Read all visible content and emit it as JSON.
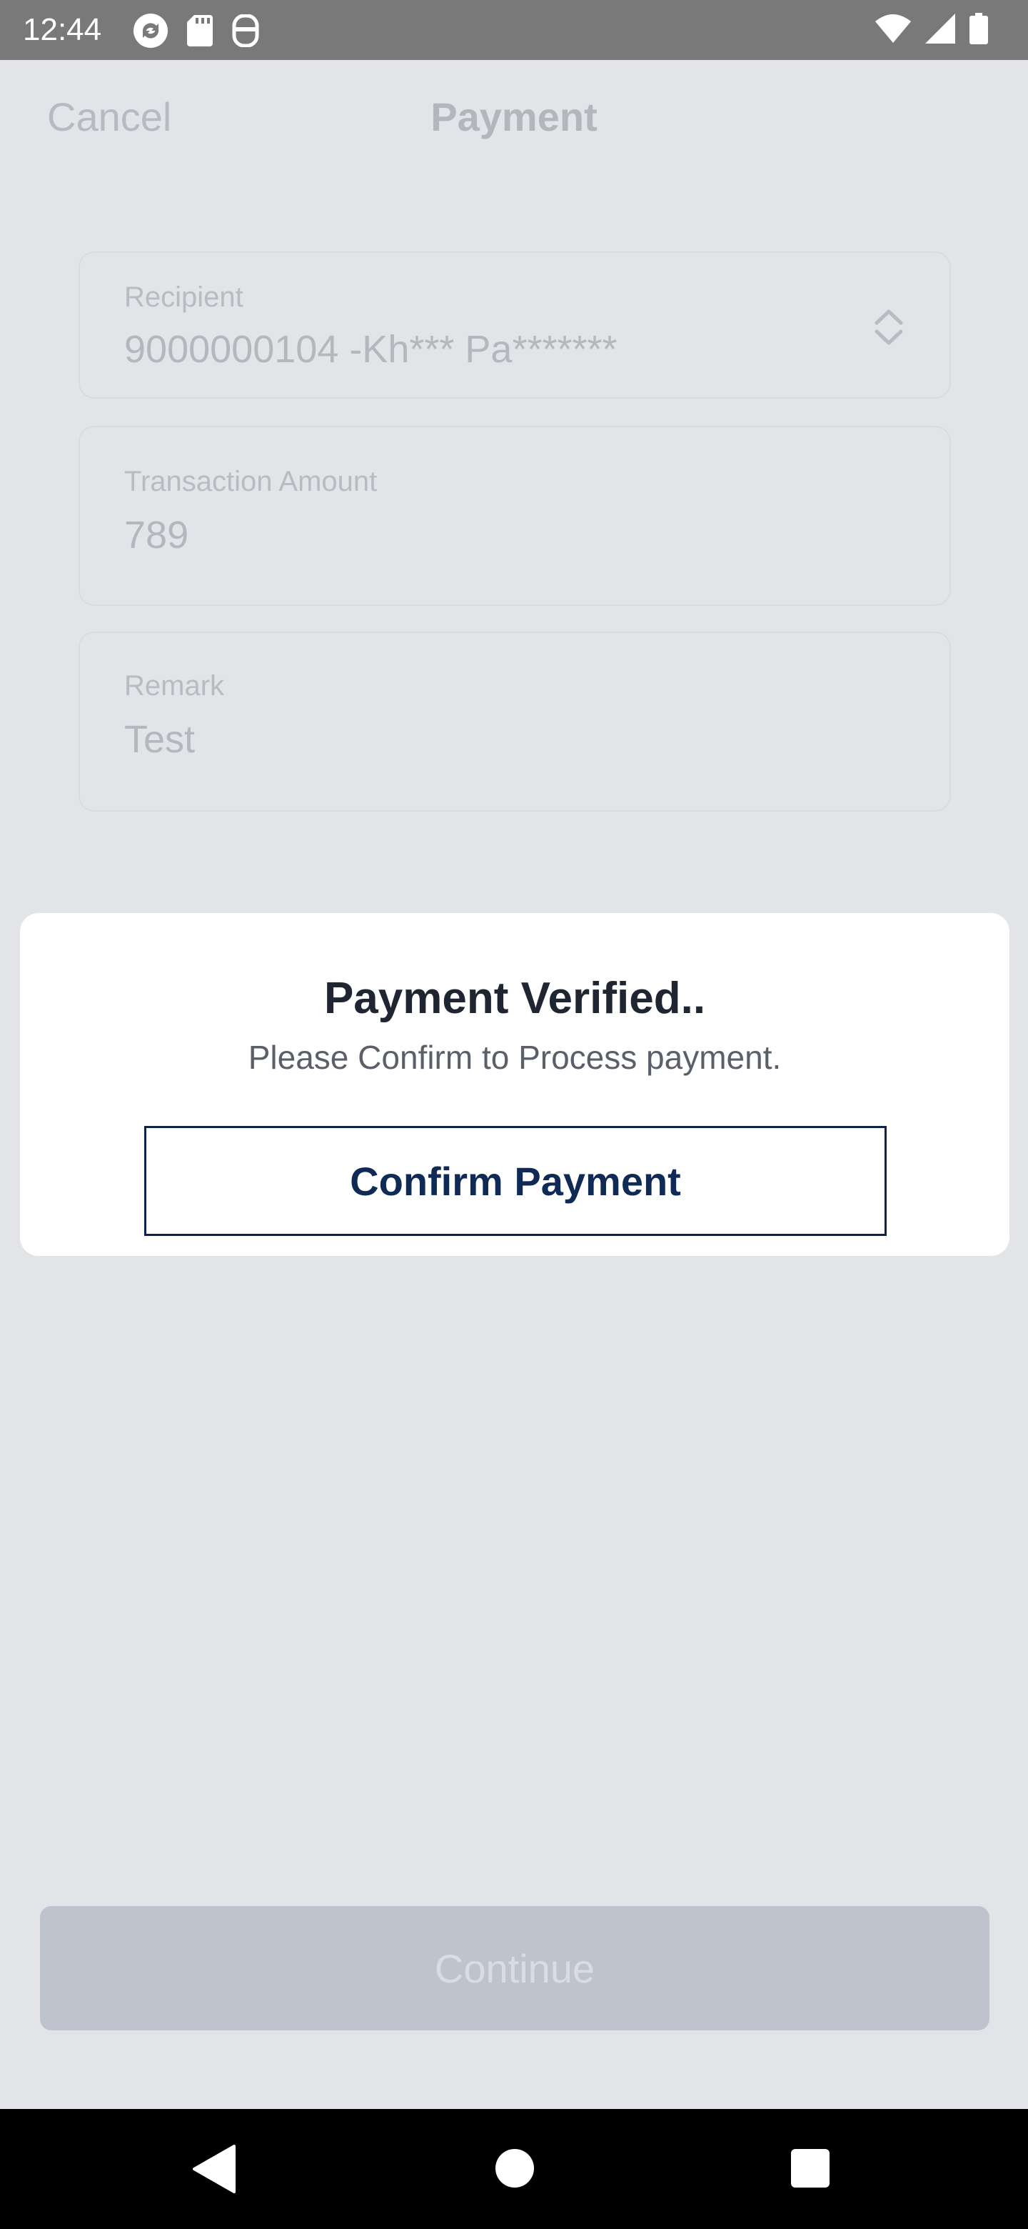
{
  "status_bar": {
    "time": "12:44",
    "left_icons": [
      "sync-icon",
      "sd-card-icon",
      "vpn-icon"
    ],
    "right_icons": [
      "wifi-icon",
      "signal-icon",
      "battery-icon"
    ]
  },
  "header": {
    "cancel_label": "Cancel",
    "title": "Payment"
  },
  "form": {
    "recipient": {
      "label": "Recipient",
      "value": "9000000104 -Kh*** Pa*******"
    },
    "amount": {
      "label": "Transaction Amount",
      "value": "789"
    },
    "remark": {
      "label": "Remark",
      "value": "Test"
    }
  },
  "dialog": {
    "title": "Payment Verified..",
    "subtitle": "Please Confirm to Process payment.",
    "confirm_label": "Confirm Payment"
  },
  "footer": {
    "continue_label": "Continue"
  },
  "colors": {
    "overlay_bg": "#e3e4e7",
    "status_bar": "#797979",
    "dialog_bg": "#ffffff",
    "primary_navy": "#0f2a55",
    "continue_disabled": "#bfc3ce",
    "nav_bar": "#000000"
  }
}
